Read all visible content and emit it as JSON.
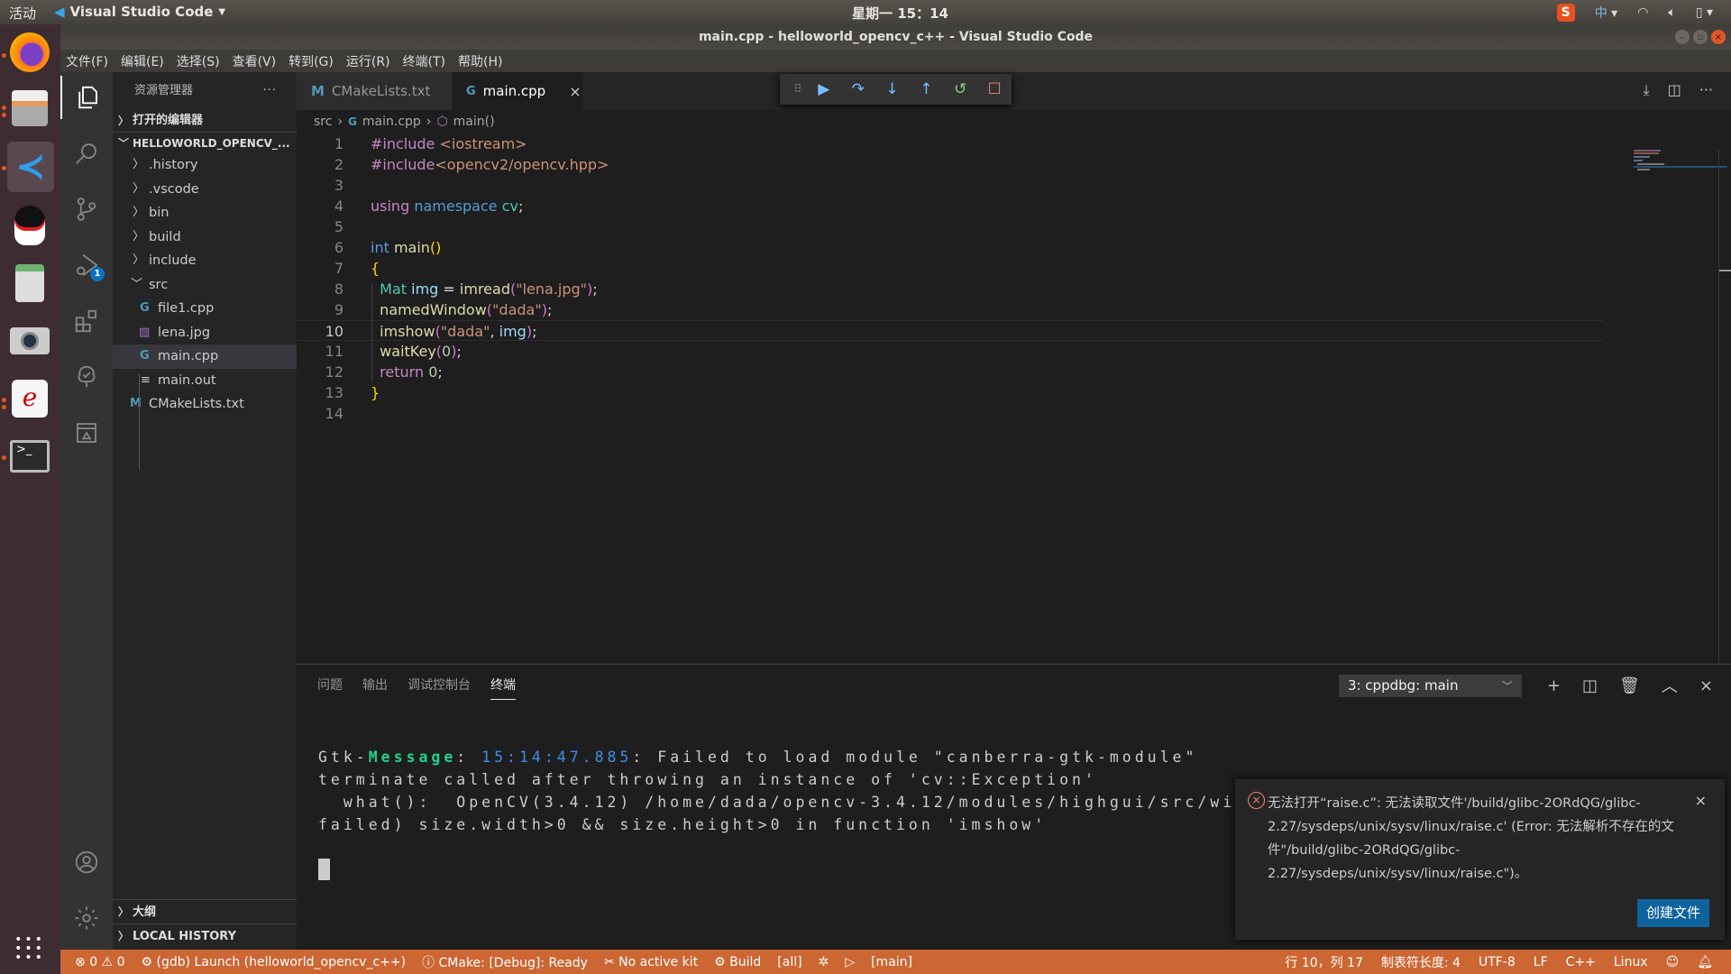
{
  "os": {
    "activities": "活动",
    "app_name": "Visual Studio Code",
    "clock": "星期一 15：14",
    "ime": "中",
    "dock_apps": [
      "Firefox",
      "Files",
      "Visual Studio Code",
      "QQ",
      "Calculator",
      "Camera",
      "Document Viewer",
      "Terminal"
    ]
  },
  "window": {
    "title": "main.cpp - helloworld_opencv_c++ - Visual Studio Code"
  },
  "menu": [
    "文件(F)",
    "编辑(E)",
    "选择(S)",
    "查看(V)",
    "转到(G)",
    "运行(R)",
    "终端(T)",
    "帮助(H)"
  ],
  "activity_bar": {
    "debug_badge": "1"
  },
  "sidebar": {
    "title": "资源管理器",
    "more": "···",
    "open_editors": "打开的编辑器",
    "project": "HELLOWORLD_OPENCV_...",
    "tree": [
      {
        "label": ".history",
        "type": "folder",
        "depth": 1,
        "expanded": false
      },
      {
        "label": ".vscode",
        "type": "folder",
        "depth": 1,
        "expanded": false
      },
      {
        "label": "bin",
        "type": "folder",
        "depth": 1,
        "expanded": false
      },
      {
        "label": "build",
        "type": "folder",
        "depth": 1,
        "expanded": false
      },
      {
        "label": "include",
        "type": "folder",
        "depth": 1,
        "expanded": false
      },
      {
        "label": "src",
        "type": "folder",
        "depth": 1,
        "expanded": true
      },
      {
        "label": "file1.cpp",
        "type": "cpp",
        "depth": 2
      },
      {
        "label": "lena.jpg",
        "type": "image",
        "depth": 2
      },
      {
        "label": "main.cpp",
        "type": "cpp",
        "depth": 2,
        "selected": true
      },
      {
        "label": "main.out",
        "type": "text",
        "depth": 2
      },
      {
        "label": "CMakeLists.txt",
        "type": "cmake",
        "depth": 1
      }
    ],
    "outline": "大纲",
    "local_history": "LOCAL HISTORY"
  },
  "tabs": [
    {
      "label": "CMakeLists.txt",
      "icon": "M",
      "active": false
    },
    {
      "label": "main.cpp",
      "icon": "C++",
      "active": true,
      "close": "×"
    }
  ],
  "breadcrumb": [
    "src",
    "main.cpp",
    "main()"
  ],
  "editor": {
    "current_line": 10,
    "lines": [
      {
        "n": "1",
        "tokens": [
          [
            "#include ",
            "#c586c0"
          ],
          [
            "<iostream>",
            "#ce9178"
          ]
        ]
      },
      {
        "n": "2",
        "tokens": [
          [
            "#include",
            "#c586c0"
          ],
          [
            "<opencv2/opencv.hpp>",
            "#ce9178"
          ]
        ]
      },
      {
        "n": "3",
        "tokens": []
      },
      {
        "n": "4",
        "tokens": [
          [
            "using ",
            "#c586c0"
          ],
          [
            "namespace ",
            "#569cd6"
          ],
          [
            "cv",
            "#4ec9b0"
          ],
          [
            ";",
            "#d4d4d4"
          ]
        ]
      },
      {
        "n": "5",
        "tokens": []
      },
      {
        "n": "6",
        "tokens": [
          [
            "int ",
            "#569cd6"
          ],
          [
            "main",
            "#dcdcaa"
          ],
          [
            "()",
            "#ffd700"
          ]
        ]
      },
      {
        "n": "7",
        "tokens": [
          [
            "{",
            "#ffd700"
          ]
        ]
      },
      {
        "n": "8",
        "tokens": [
          [
            "  ",
            "#d4d4d4"
          ],
          [
            "Mat ",
            "#4ec9b0"
          ],
          [
            "img",
            "#9cdcfe"
          ],
          [
            " = ",
            "#d4d4d4"
          ],
          [
            "imread",
            "#dcdcaa"
          ],
          [
            "(",
            "#da70d6"
          ],
          [
            "\"lena.jpg\"",
            "#ce9178"
          ],
          [
            ")",
            "#da70d6"
          ],
          [
            ";",
            "#d4d4d4"
          ]
        ]
      },
      {
        "n": "9",
        "tokens": [
          [
            "  ",
            "#d4d4d4"
          ],
          [
            "namedWindow",
            "#dcdcaa"
          ],
          [
            "(",
            "#da70d6"
          ],
          [
            "\"dada\"",
            "#ce9178"
          ],
          [
            ")",
            "#da70d6"
          ],
          [
            ";",
            "#d4d4d4"
          ]
        ]
      },
      {
        "n": "10",
        "tokens": [
          [
            "  ",
            "#d4d4d4"
          ],
          [
            "imshow",
            "#dcdcaa"
          ],
          [
            "(",
            "#da70d6"
          ],
          [
            "\"dada\"",
            "#ce9178"
          ],
          [
            ", ",
            "#d4d4d4"
          ],
          [
            "img",
            "#9cdcfe"
          ],
          [
            ")",
            "#da70d6"
          ],
          [
            ";",
            "#d4d4d4"
          ]
        ]
      },
      {
        "n": "11",
        "tokens": [
          [
            "  ",
            "#d4d4d4"
          ],
          [
            "waitKey",
            "#dcdcaa"
          ],
          [
            "(",
            "#da70d6"
          ],
          [
            "0",
            "#b5cea8"
          ],
          [
            ")",
            "#da70d6"
          ],
          [
            ";",
            "#d4d4d4"
          ]
        ]
      },
      {
        "n": "12",
        "tokens": [
          [
            "  ",
            "#d4d4d4"
          ],
          [
            "return ",
            "#c586c0"
          ],
          [
            "0",
            "#b5cea8"
          ],
          [
            ";",
            "#d4d4d4"
          ]
        ]
      },
      {
        "n": "13",
        "tokens": [
          [
            "}",
            "#ffd700"
          ]
        ]
      },
      {
        "n": "14",
        "tokens": []
      }
    ]
  },
  "panel": {
    "tabs": [
      "问题",
      "输出",
      "调试控制台",
      "终端"
    ],
    "active_tab": "终端",
    "terminal_select": "3: cppdbg: main",
    "terminal": {
      "line1_prefix": "Gtk-",
      "line1_msg": "Message",
      "line1_sep": ": ",
      "line1_time": "15:14:47.885",
      "line1_rest": ": Failed to load module \"canberra-gtk-module\"",
      "line2": "terminate called after throwing an instance of 'cv::Exception'",
      "line3": "  what():  OpenCV(3.4.12) /home/dada/opencv-3.4.12/modules/highgui/src/wi",
      "line4": "failed) size.width>0 && size.height>0 in function 'imshow'"
    }
  },
  "notification": {
    "message": "无法打开“raise.c”: 无法读取文件'/build/glibc-2ORdQG/glibc-2.27/sysdeps/unix/sysv/linux/raise.c' (Error: 无法解析不存在的文件\"/build/glibc-2ORdQG/glibc-2.27/sysdeps/unix/sysv/linux/raise.c\")。",
    "action": "创建文件",
    "close": "×"
  },
  "status": {
    "errors": "0",
    "warnings": "0",
    "launch": "(gdb) Launch (helloworld_opencv_c++)",
    "cmake": "CMake: [Debug]: Ready",
    "kit": "No active kit",
    "build": "Build",
    "target": "[all]",
    "run_target": "[main]",
    "position": "行 10，列 17",
    "tab_size": "制表符长度: 4",
    "encoding": "UTF-8",
    "eol": "LF",
    "language": "C++",
    "platform": "Linux"
  },
  "colors": {
    "status_bar": "#cc6633",
    "accent_button": "#0e639c",
    "error": "#f48771"
  }
}
